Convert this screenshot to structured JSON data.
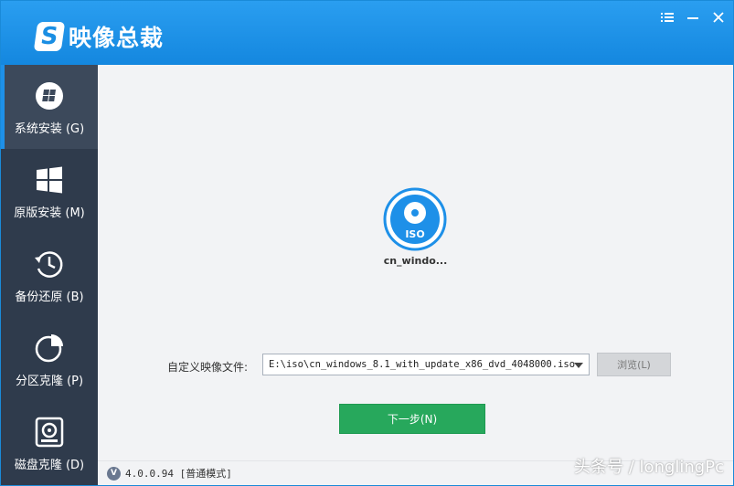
{
  "app": {
    "title": "映像总裁",
    "logo_letter": "S"
  },
  "window_controls": {
    "menu_icon": "menu-icon",
    "minimize_icon": "minimize-icon",
    "close_icon": "close-icon"
  },
  "sidebar": {
    "items": [
      {
        "label": "系统安装 (G)",
        "icon": "windows-disc-icon",
        "active": true
      },
      {
        "label": "原版安装 (M)",
        "icon": "windows-logo-icon",
        "active": false
      },
      {
        "label": "备份还原 (B)",
        "icon": "restore-clock-icon",
        "active": false
      },
      {
        "label": "分区克隆 (P)",
        "icon": "pie-chart-icon",
        "active": false
      },
      {
        "label": "磁盘克隆 (D)",
        "icon": "disk-clone-icon",
        "active": false
      }
    ]
  },
  "main": {
    "iso_icon_label": "ISO",
    "iso_name": "cn_windo...",
    "field_label": "自定义映像文件:",
    "file_value": "E:\\iso\\cn_windows_8.1_with_update_x86_dvd_4048000.iso",
    "browse_label": "浏览(L)",
    "next_label": "下一步(N)"
  },
  "status": {
    "badge": "V",
    "version": "4.0.0.94 [普通模式]"
  },
  "watermark": "头条号 / longlingPc",
  "colors": {
    "titlebar": "#1a8ee3",
    "sidebar": "#2f3b4c",
    "accent": "#1e90e8",
    "next_button": "#27a85c"
  }
}
